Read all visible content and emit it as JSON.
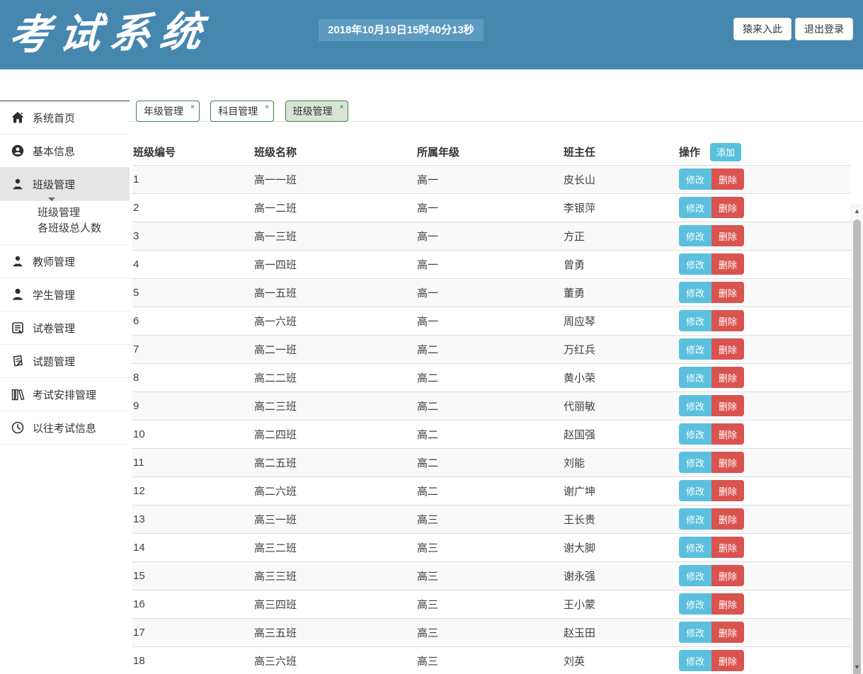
{
  "header": {
    "logo_text": "考试系统",
    "datetime": "2018年10月19日15时40分13秒",
    "nav_buttons": [
      {
        "label": "猿来入此"
      },
      {
        "label": "退出登录"
      }
    ]
  },
  "sidebar": {
    "items": [
      {
        "label": "系统首页",
        "icon": "home-icon"
      },
      {
        "label": "基本信息",
        "icon": "user-circle-icon"
      },
      {
        "label": "班级管理",
        "icon": "person-icon",
        "active": true,
        "submenu": [
          {
            "label": "班级管理"
          },
          {
            "label": "各班级总人数"
          }
        ]
      },
      {
        "label": "教师管理",
        "icon": "person-icon"
      },
      {
        "label": "学生管理",
        "icon": "student-icon"
      },
      {
        "label": "试卷管理",
        "icon": "document-icon"
      },
      {
        "label": "试题管理",
        "icon": "pen-paper-icon"
      },
      {
        "label": "考试安排管理",
        "icon": "books-icon"
      },
      {
        "label": "以往考试信息",
        "icon": "clock-icon"
      }
    ]
  },
  "tabs": [
    {
      "label": "年级管理",
      "close": "×",
      "active": false
    },
    {
      "label": "科目管理",
      "close": "×",
      "active": false
    },
    {
      "label": "班级管理",
      "close": "×",
      "active": true
    }
  ],
  "table": {
    "columns": [
      "班级编号",
      "班级名称",
      "所属年级",
      "班主任",
      "操作"
    ],
    "add_button": "添加",
    "edit_button": "修改",
    "delete_button": "删除",
    "rows": [
      {
        "id": "1",
        "name": "高一一班",
        "grade": "高一",
        "teacher": "皮长山"
      },
      {
        "id": "2",
        "name": "高一二班",
        "grade": "高一",
        "teacher": "李银萍"
      },
      {
        "id": "3",
        "name": "高一三班",
        "grade": "高一",
        "teacher": "方正"
      },
      {
        "id": "4",
        "name": "高一四班",
        "grade": "高一",
        "teacher": "曾勇"
      },
      {
        "id": "5",
        "name": "高一五班",
        "grade": "高一",
        "teacher": "董勇"
      },
      {
        "id": "6",
        "name": "高一六班",
        "grade": "高一",
        "teacher": "周应琴"
      },
      {
        "id": "7",
        "name": "高二一班",
        "grade": "高二",
        "teacher": "万红兵"
      },
      {
        "id": "8",
        "name": "高二二班",
        "grade": "高二",
        "teacher": "黄小荣"
      },
      {
        "id": "9",
        "name": "高二三班",
        "grade": "高二",
        "teacher": "代丽敏"
      },
      {
        "id": "10",
        "name": "高二四班",
        "grade": "高二",
        "teacher": "赵国强"
      },
      {
        "id": "11",
        "name": "高二五班",
        "grade": "高二",
        "teacher": "刘能"
      },
      {
        "id": "12",
        "name": "高二六班",
        "grade": "高二",
        "teacher": "谢广坤"
      },
      {
        "id": "13",
        "name": "高三一班",
        "grade": "高三",
        "teacher": "王长贵"
      },
      {
        "id": "14",
        "name": "高三二班",
        "grade": "高三",
        "teacher": "谢大脚"
      },
      {
        "id": "15",
        "name": "高三三班",
        "grade": "高三",
        "teacher": "谢永强"
      },
      {
        "id": "16",
        "name": "高三四班",
        "grade": "高三",
        "teacher": "王小蒙"
      },
      {
        "id": "17",
        "name": "高三五班",
        "grade": "高三",
        "teacher": "赵玉田"
      },
      {
        "id": "18",
        "name": "高三六班",
        "grade": "高三",
        "teacher": "刘英"
      }
    ]
  },
  "scrollbar": {
    "up_glyph": "▲",
    "down_glyph": "▼"
  },
  "colors": {
    "header_bg": "#4687b0",
    "datetime_bg": "#5d9ac1",
    "tab_border_green": "#41804e",
    "tab_active_bg": "#d6e5d4",
    "info_blue": "#5bc0de",
    "danger_red": "#d9534f",
    "row_stripe": "#f9f9f9"
  }
}
